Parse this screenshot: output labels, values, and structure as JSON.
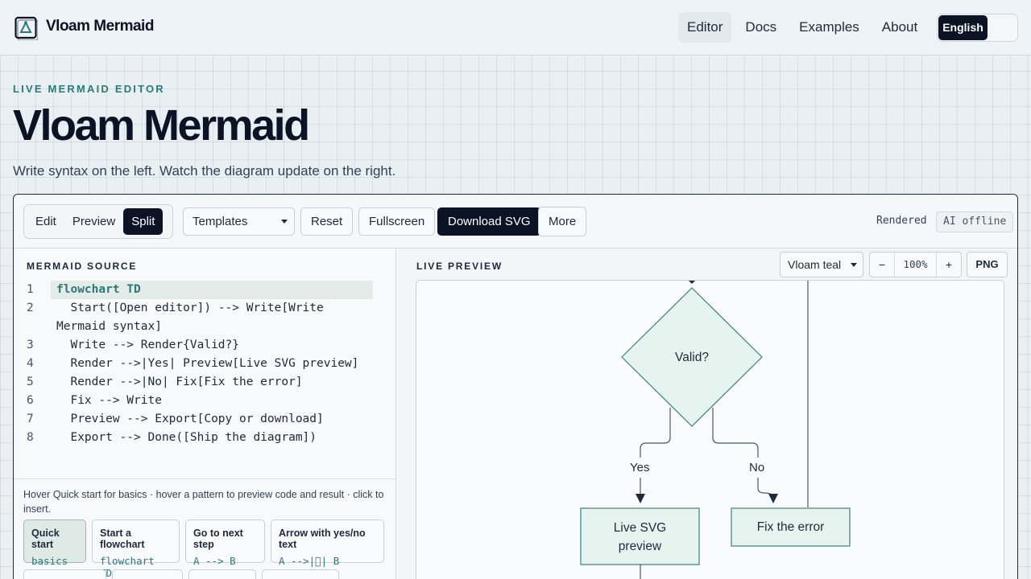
{
  "header": {
    "brand": "Vloam Mermaid",
    "nav": [
      "Editor",
      "Docs",
      "Examples",
      "About"
    ],
    "active_nav": "Editor",
    "language": "English"
  },
  "hero": {
    "eyebrow": "LIVE MERMAID EDITOR",
    "title": "Vloam Mermaid",
    "subtitle": "Write syntax on the left. Watch the diagram update on the right."
  },
  "toolbar": {
    "modes": [
      "Edit",
      "Preview",
      "Split"
    ],
    "active_mode": "Split",
    "templates": "Templates",
    "reset": "Reset",
    "fullscreen": "Fullscreen",
    "download_svg": "Download SVG",
    "more": "More",
    "status": "Rendered",
    "ai_status": "AI offline"
  },
  "source": {
    "label": "MERMAID SOURCE",
    "lines": [
      {
        "n": "1",
        "text": "flowchart TD"
      },
      {
        "n": "2",
        "text": "  Start([Open editor]) --> Write[Write\nMermaid syntax]"
      },
      {
        "n": "3",
        "text": "  Write --> Render{Valid?}"
      },
      {
        "n": "4",
        "text": "  Render -->|Yes| Preview[Live SVG preview]"
      },
      {
        "n": "5",
        "text": "  Render -->|No| Fix[Fix the error]"
      },
      {
        "n": "6",
        "text": "  Fix --> Write"
      },
      {
        "n": "7",
        "text": "  Preview --> Export[Copy or download]"
      },
      {
        "n": "8",
        "text": "  Export --> Done([Ship the diagram])"
      }
    ],
    "help": "Hover Quick start for basics · hover a pattern to preview code and result · click to insert.",
    "chips": [
      {
        "title": "Quick start",
        "code": "basics"
      },
      {
        "title": "Start a flowchart",
        "code": "flowchart TD"
      },
      {
        "title": "Go to next step",
        "code": "A --> B"
      },
      {
        "title": "Arrow with yes/no text",
        "code": "A -->|\u0000| B"
      }
    ]
  },
  "preview": {
    "label": "LIVE PREVIEW",
    "theme": "Vloam teal",
    "zoom_out": "−",
    "zoom": "100%",
    "zoom_in": "+",
    "png": "PNG",
    "nodes": {
      "decision": "Valid?",
      "yes_label": "Yes",
      "no_label": "No",
      "preview_node": "Live SVG preview",
      "fix_node": "Fix the error"
    }
  },
  "colors": {
    "accent": "#2b7a78",
    "dark": "#0b1324",
    "node_fill": "#e6f4f0",
    "node_stroke": "#3f7f7a"
  }
}
